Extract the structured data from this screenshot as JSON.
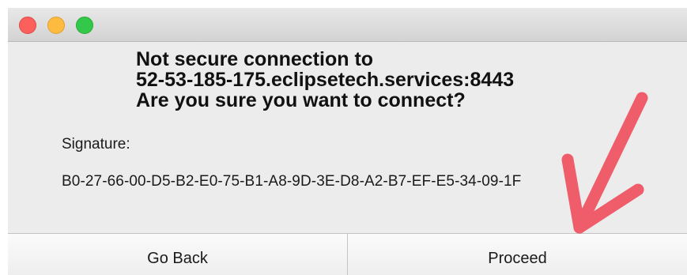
{
  "dialog": {
    "heading_lines": [
      "Not secure connection to",
      "52-53-185-175.eclipsetech.services:8443",
      "Are you sure you want to connect?"
    ],
    "signature_label": "Signature:",
    "signature_value": "B0-27-66-00-D5-B2-E0-75-B1-A8-9D-3E-D8-A2-B7-EF-E5-34-09-1F"
  },
  "buttons": {
    "go_back": "Go Back",
    "proceed": "Proceed"
  },
  "colors": {
    "close": "#fc605c",
    "minimize": "#fdbc40",
    "zoom": "#34c84a",
    "annotation_arrow": "#f0505f"
  },
  "annotation": {
    "icon": "arrow-down-left-icon"
  }
}
